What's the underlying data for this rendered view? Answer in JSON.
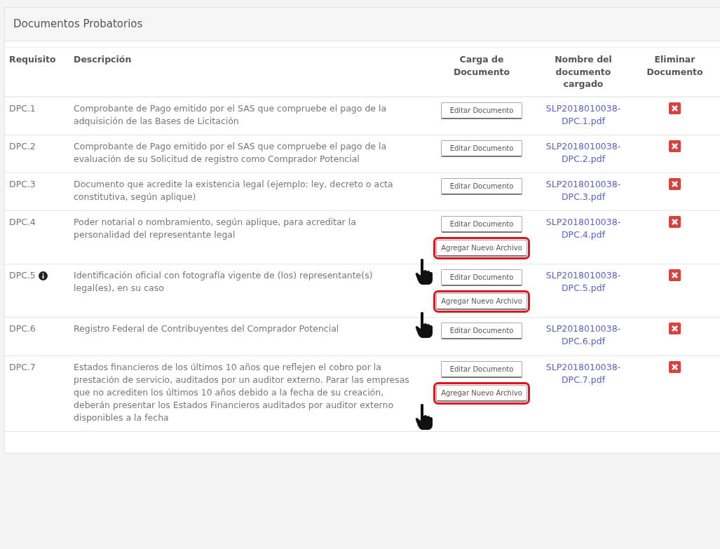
{
  "panel": {
    "title": "Documentos Probatorios"
  },
  "table": {
    "columns": [
      "Requisito",
      "Descripción",
      "Carga de Documento",
      "Nombre del documento cargado",
      "Eliminar Documento"
    ],
    "rows": [
      {
        "code": "DPC.1",
        "info": false,
        "description": "Comprobante de Pago emitido por el SAS que compruebe el pago de la adquisición de las Bases de Licitación",
        "edit_button": "Editar Documento",
        "add_button": null,
        "file": "SLP2018010038-DPC.1.pdf"
      },
      {
        "code": "DPC.2",
        "info": false,
        "description": "Comprobante de Pago emitido por el SAS que compruebe el pago de la evaluación de su Solicitud de registro como Comprador Potencial",
        "edit_button": "Editar Documento",
        "add_button": null,
        "file": "SLP2018010038-DPC.2.pdf"
      },
      {
        "code": "DPC.3",
        "info": false,
        "description": "Documento que acredite la existencia legal (ejemplo: ley, decreto o acta constitutiva, según aplique)",
        "edit_button": "Editar Documento",
        "add_button": null,
        "file": "SLP2018010038-DPC.3.pdf"
      },
      {
        "code": "DPC.4",
        "info": false,
        "description": "Poder notarial o nombramiento, según aplique, para acreditar la personalidad del representante legal",
        "edit_button": "Editar Documento",
        "add_button": {
          "label": "Agregar Nuevo Archivo",
          "highlighted": true,
          "pointer": true
        },
        "file": "SLP2018010038-DPC.4.pdf"
      },
      {
        "code": "DPC.5",
        "info": true,
        "description": "Identificación oficial con fotografía vigente de (los) representante(s) legal(es), en su caso",
        "edit_button": "Editar Documento",
        "add_button": {
          "label": "Agregar Nuevo Archivo",
          "highlighted": true,
          "pointer": true
        },
        "file": "SLP2018010038-DPC.5.pdf"
      },
      {
        "code": "DPC.6",
        "info": false,
        "description": "Registro Federal de Contribuyentes del Comprador Potencial",
        "edit_button": "Editar Documento",
        "add_button": null,
        "file": "SLP2018010038-DPC.6.pdf"
      },
      {
        "code": "DPC.7",
        "info": false,
        "description": "Estados financieros de los últimos 10 años que reflejen el cobro por la prestación de servicio, auditados por un auditor externo. Parar las empresas que no acrediten los últimos 10 años debido a la fecha de su creación, deberán presentar los Estados Financieros auditados por auditor externo disponibles a la fecha",
        "edit_button": "Editar Documento",
        "add_button": {
          "label": "Agregar Nuevo Archivo",
          "highlighted": true,
          "pointer": true
        },
        "file": "SLP2018010038-DPC.7.pdf"
      }
    ]
  }
}
